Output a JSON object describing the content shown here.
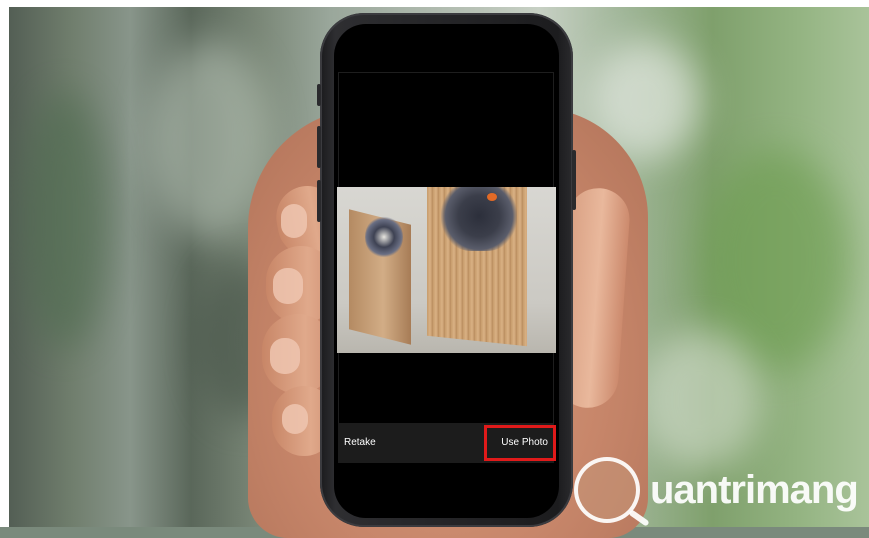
{
  "camera_review": {
    "retake_label": "Retake",
    "use_photo_label": "Use Photo"
  },
  "watermark": {
    "text": "uantrimang"
  },
  "colors": {
    "highlight_box": "#e01a1a",
    "toolbar_bg": "#1c1c1c",
    "button_text": "#ffffff"
  }
}
